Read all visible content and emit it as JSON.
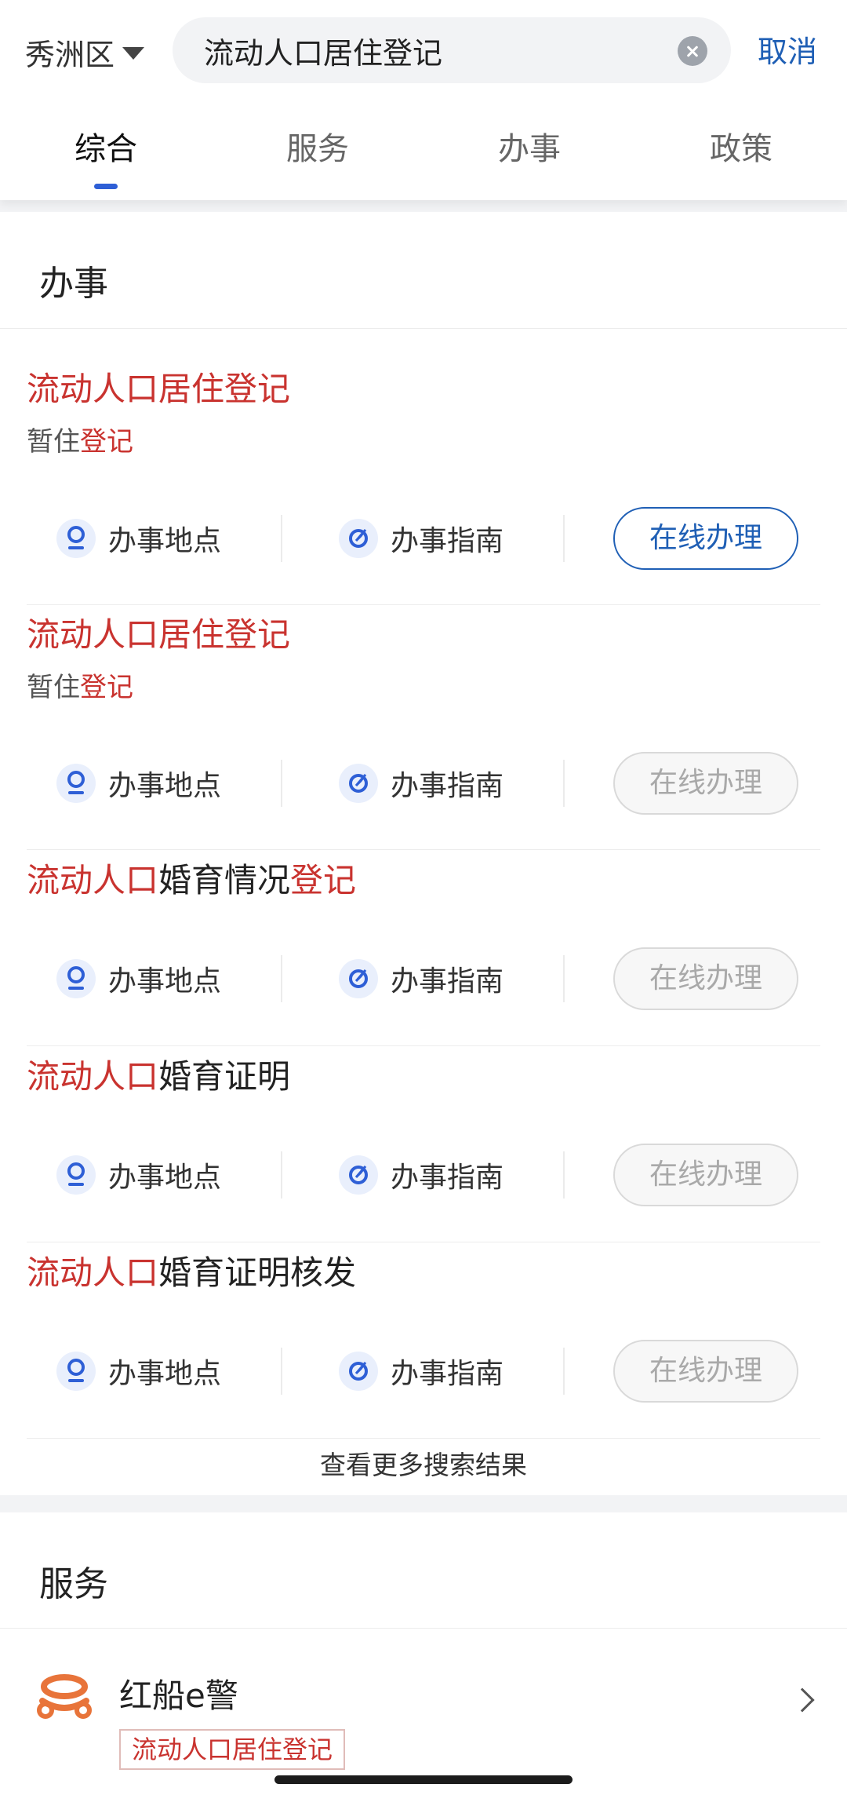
{
  "header": {
    "region": "秀洲区",
    "search_value": "流动人口居住登记",
    "cancel": "取消"
  },
  "tabs": [
    {
      "label": "综合",
      "active": true
    },
    {
      "label": "服务",
      "active": false
    },
    {
      "label": "办事",
      "active": false
    },
    {
      "label": "政策",
      "active": false
    }
  ],
  "banshi": {
    "section_title": "办事",
    "action_location": "办事地点",
    "action_guide": "办事指南",
    "online_label": "在线办理",
    "items": [
      {
        "title_hl": "流动人口居住登记",
        "title_rest": "",
        "title_hl2": "",
        "sub_pre": "暂住",
        "sub_hl": "登记",
        "online_enabled": true
      },
      {
        "title_hl": "流动人口居住登记",
        "title_rest": "",
        "title_hl2": "",
        "sub_pre": "暂住",
        "sub_hl": "登记",
        "online_enabled": false
      },
      {
        "title_hl": "流动人口",
        "title_rest": "婚育情况",
        "title_hl2": "登记",
        "sub_pre": "",
        "sub_hl": "",
        "online_enabled": false
      },
      {
        "title_hl": "流动人口",
        "title_rest": "婚育证明",
        "title_hl2": "",
        "sub_pre": "",
        "sub_hl": "",
        "online_enabled": false
      },
      {
        "title_hl": "流动人口",
        "title_rest": "婚育证明核发",
        "title_hl2": "",
        "sub_pre": "",
        "sub_hl": "",
        "online_enabled": false
      }
    ],
    "more": "查看更多搜索结果"
  },
  "service": {
    "section_title": "服务",
    "items": [
      {
        "icon": "police-badge-icon",
        "name": "红船e警",
        "tag": "流动人口居住登记"
      }
    ]
  },
  "colors": {
    "highlight": "#c9332f",
    "accent": "#1f5fb5",
    "tab_underline": "#2e5fd6",
    "service_icon": "#e8743a"
  }
}
